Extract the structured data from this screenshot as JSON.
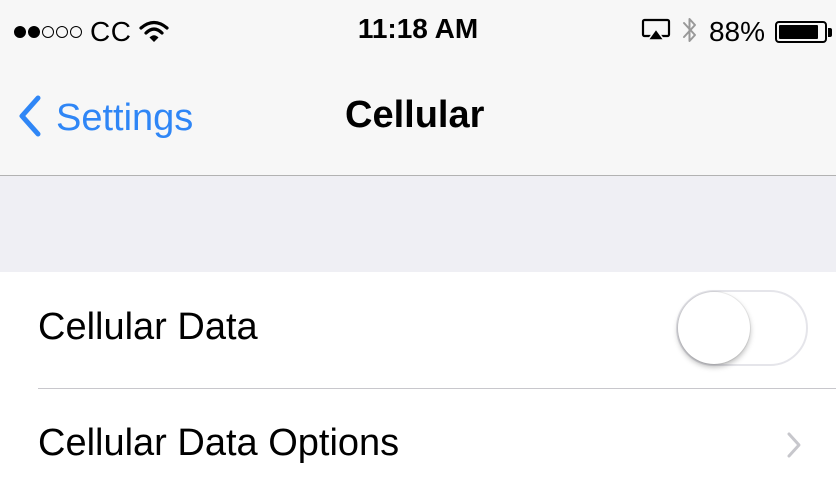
{
  "status_bar": {
    "signal_dots_filled": 2,
    "signal_dots_total": 5,
    "carrier": "CC",
    "wifi_icon": "wifi-icon",
    "time": "11:18 AM",
    "airplay_icon": "airplay-icon",
    "bluetooth_icon": "bluetooth-icon",
    "battery_percent": "88%",
    "battery_level": 0.88
  },
  "nav": {
    "back_label": "Settings",
    "back_icon": "chevron-left-icon",
    "title": "Cellular"
  },
  "rows": [
    {
      "label": "Cellular Data",
      "control": "toggle",
      "toggle_on": false
    },
    {
      "label": "Cellular Data Options",
      "control": "disclosure",
      "icon": "chevron-right-icon"
    }
  ],
  "colors": {
    "accent": "#2f86f6",
    "background": "#efeff4",
    "bar": "#f7f7f7",
    "separator": "#c8c7cc",
    "chevron": "#c7c7cc"
  }
}
